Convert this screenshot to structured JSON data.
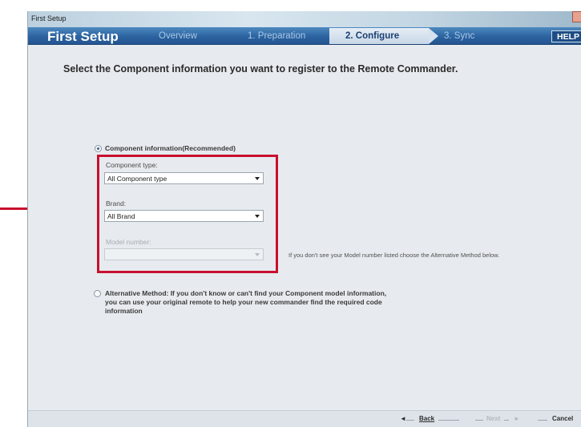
{
  "window": {
    "title": "First Setup"
  },
  "nav": {
    "title": "First Setup",
    "steps": [
      {
        "label": "Overview"
      },
      {
        "label": "1. Preparation"
      },
      {
        "label": "2. Configure"
      },
      {
        "label": "3. Sync"
      }
    ],
    "active_step": 2,
    "help_label": "HELP"
  },
  "main": {
    "heading": "Select the Component information you want to register to the Remote Commander.",
    "option_component": {
      "label": "Component information(Recommended)",
      "selected": true
    },
    "component_type": {
      "label": "Component type:",
      "value": "All Component type"
    },
    "brand": {
      "label": "Brand:",
      "value": "All Brand"
    },
    "model_number": {
      "label": "Model number:",
      "value": "",
      "disabled": true
    },
    "model_hint": "If you don't see your Model number listed choose the Alternative Method below.",
    "option_alternative": {
      "line1": "Alternative Method: If you don't know or can't find your Component model information,",
      "line2": "you can use your original remote to help your new commander find the required code",
      "line3": "information",
      "selected": false
    }
  },
  "footer": {
    "back_label": "Back",
    "next_label": "Next",
    "cancel_label": "Cancel"
  },
  "colors": {
    "highlight": "#c8102e",
    "nav_bg": "#2c63a0"
  }
}
